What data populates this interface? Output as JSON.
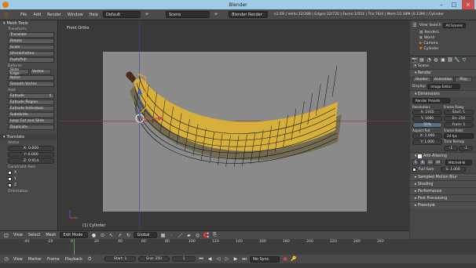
{
  "window": {
    "title": "Blender",
    "minimize": "–",
    "maximize": "□",
    "close": "×"
  },
  "info_header": {
    "menus": [
      "File",
      "Add",
      "Render",
      "Window",
      "Help"
    ],
    "layout": "Default",
    "scene": "Scene",
    "engine": "Blender Render",
    "stats": "v2.69 | Verts:32/288 | Edges:32/720 | Faces:1/554 | Tris:76/4 | Mem:10.38M (0.10M) | Cylinder"
  },
  "tool_shelf": {
    "title": "Mesh Tools",
    "transform_label": "Transform:",
    "transform_buttons": [
      "Translate",
      "Rotate",
      "Scale",
      "Shrink/Fatten",
      "Push/Pull"
    ],
    "deform_label": "Deform:",
    "slide_edge": "Slide Edge",
    "slide_vertex": "Vertex",
    "noise": "Noise",
    "smooth_vertex": "Smooth Vertex",
    "add_label": "Add:",
    "extrude": "Extrude",
    "add_buttons": [
      "Extrude Region",
      "Extrude Individual",
      "Subdivide",
      "Loop Cut and Slide",
      "Duplicate"
    ],
    "translate_panel": "Translate",
    "vector_label": "Vector",
    "x": "X: 0.000",
    "y": "Y: 0.000",
    "z": "Z: 0.914",
    "constraint_label": "Constraint Axis",
    "cx": "X",
    "cy": "Y",
    "cz": "Z",
    "orientation_label": "Orientation"
  },
  "viewport": {
    "view_label": "Front Ortho",
    "object_label": "(1) Cylinder"
  },
  "viewport_header": {
    "menus": [
      "View",
      "Select",
      "Mesh"
    ],
    "mode": "Edit Mode",
    "orientation": "Global"
  },
  "outliner": {
    "items": [
      "View",
      "Search",
      "All Scenes",
      "RenderL",
      "World",
      "Camera",
      "Cylinder"
    ]
  },
  "properties": {
    "scene_label": "Scene",
    "render_section": "Render",
    "render_buttons": [
      "Render",
      "Animation",
      "Play"
    ],
    "display_label": "Display:",
    "display_value": "Image Editor",
    "dimensions_section": "Dimensions",
    "render_presets": "Render Presets",
    "resolution_label": "Resolution:",
    "frame_range_label": "Frame Rang",
    "res_x": "X: 1920",
    "res_y": "Y: 1080",
    "res_pct": "50%",
    "start_frame": "Start: 1",
    "end_frame": "En: 250",
    "frame_step": "Fram: 1",
    "aspect_label": "Aspect Rat",
    "frame_rate_label": "Frame Rate:",
    "aspect_x": "X: 1.000",
    "aspect_y": "Y: 1.000",
    "fps": "24 fps",
    "time_remap_label": "Time Remap",
    "old": "-1",
    "new": "-1",
    "aa_section": "Anti-Aliasing",
    "aa_samples": [
      "5",
      "8",
      "11",
      "16"
    ],
    "filter": "Mitchell-N",
    "full_sample": "Full Sam",
    "filter_size": "S: 1.000",
    "collapsed_sections": [
      "Sampled Motion Blur",
      "Shading",
      "Performance",
      "Post Processing",
      "Freestyle"
    ]
  },
  "timeline": {
    "ticks": [
      "-40",
      "-20",
      "0",
      "20",
      "40",
      "60",
      "80",
      "100",
      "120",
      "140",
      "160",
      "180",
      "200",
      "220",
      "240",
      "260"
    ],
    "current_frame": 1,
    "menus": [
      "View",
      "Marker",
      "Frame",
      "Playback"
    ],
    "start": "Start: 1",
    "end": "End: 250",
    "current": "1",
    "sync": "No Sync"
  },
  "colors": {
    "accent": "#e87d0d",
    "selected_wire": "#f5a623",
    "timeline_cursor": "#4ca64c",
    "axis_red": "#c8504b",
    "axis_blue": "#3a5fcd"
  }
}
